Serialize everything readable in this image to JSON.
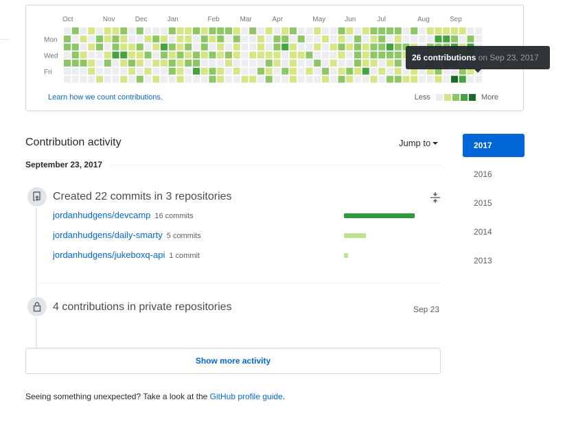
{
  "graph": {
    "months": [
      {
        "label": "Oct",
        "col": 0
      },
      {
        "label": "Nov",
        "col": 5
      },
      {
        "label": "Dec",
        "col": 9
      },
      {
        "label": "Jan",
        "col": 13
      },
      {
        "label": "Feb",
        "col": 18
      },
      {
        "label": "Mar",
        "col": 22
      },
      {
        "label": "Apr",
        "col": 26
      },
      {
        "label": "May",
        "col": 31
      },
      {
        "label": "Jun",
        "col": 35
      },
      {
        "label": "Jul",
        "col": 39
      },
      {
        "label": "Aug",
        "col": 44
      },
      {
        "label": "Sep",
        "col": 48
      }
    ],
    "day_labels": [
      {
        "label": "Mon",
        "row": 1
      },
      {
        "label": "Wed",
        "row": 3
      },
      {
        "label": "Fri",
        "row": 5
      }
    ],
    "weeks": [
      "0220200",
      "2022200",
      "0101200",
      "1010110",
      "0220001",
      "1101200",
      "1223000",
      "2113101",
      "0011210",
      "2021102",
      "0102010",
      "0210101",
      "0132100",
      "2021220",
      "1112111",
      "1121200",
      "2002230",
      "1221010",
      "2102022",
      "2211011",
      "2002100",
      "1211010",
      "0000001",
      "2001001",
      "0111020",
      "1001212",
      "0221100",
      "1230020",
      "2011111",
      "0201000",
      "0002010",
      "1010200",
      "0100021",
      "0010100",
      "2121012",
      "1010021",
      "0222210",
      "1011130",
      "2122101",
      "2222010",
      "2032102",
      "2122212",
      "0021001",
      "2012011",
      "0000000",
      "1021210",
      "1321021",
      "1321200",
      "1231200",
      "1011023",
      "0232010",
      "0000000"
    ],
    "colors": [
      "#ebedf0",
      "#d6e685",
      "#8cc665",
      "#44a340",
      "#1e6823"
    ],
    "learn_link": "Learn how we count contributions.",
    "legend_less": "Less",
    "legend_more": "More"
  },
  "tooltip": {
    "count": "26 contributions",
    "date": " on Sep 23, 2017"
  },
  "activity": {
    "title": "Contribution activity",
    "jump_to": "Jump to",
    "date": "September 23, 2017",
    "commits": {
      "title": "Created 22 commits in 3 repositories",
      "repos": [
        {
          "name": "jordanhudgens/devcamp",
          "count": "16 commits",
          "value": 16,
          "color": "#2c9c3f"
        },
        {
          "name": "jordanhudgens/daily-smarty",
          "count": "5 commits",
          "value": 5,
          "color": "#bfe38d"
        },
        {
          "name": "jordanhudgens/jukeboxq-api",
          "count": "1 commit",
          "value": 1,
          "color": "#bfe38d"
        }
      ]
    },
    "private": {
      "title": "4 contributions in private repositories",
      "date": "Sep 23"
    },
    "show_more": "Show more activity",
    "footer_text": "Seeing something unexpected? Take a look at the ",
    "footer_link": "GitHub profile guide",
    "footer_end": "."
  },
  "years": [
    {
      "label": "2017",
      "selected": true
    },
    {
      "label": "2016",
      "selected": false
    },
    {
      "label": "2015",
      "selected": false
    },
    {
      "label": "2014",
      "selected": false
    },
    {
      "label": "2013",
      "selected": false
    }
  ]
}
